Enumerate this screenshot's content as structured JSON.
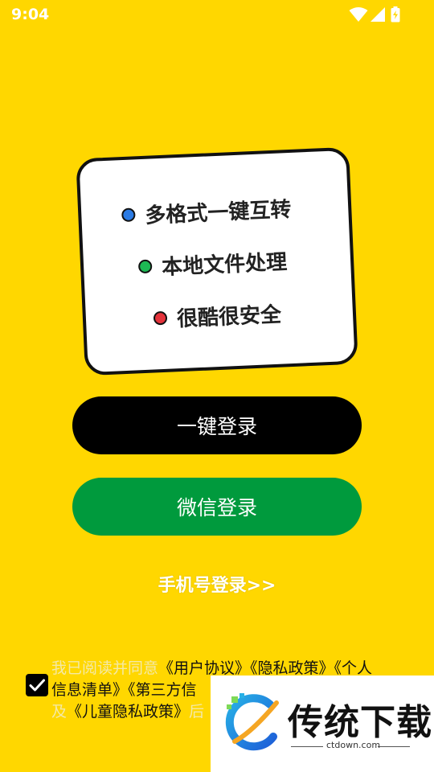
{
  "status_bar": {
    "time": "9:04",
    "icons": [
      "wifi-icon",
      "signal-icon",
      "battery-charging-icon"
    ]
  },
  "features": [
    {
      "text": "多格式一键互转",
      "dot_color": "#2B7BE4"
    },
    {
      "text": "本地文件处理",
      "dot_color": "#1DB954"
    },
    {
      "text": "很酷很安全",
      "dot_color": "#E4333B"
    }
  ],
  "buttons": {
    "onekey_login": "一键登录",
    "wechat_login": "微信登录",
    "phone_login": "手机号登录>>"
  },
  "agreement": {
    "checked": true,
    "line1_plain": "我已阅读并同意",
    "link_user": "《用户协议》",
    "link_privacy": "《隐私政策》",
    "link_personal_1": "《个人",
    "link_personal_2": "信息清单》",
    "link_thirdparty_partial": "《第三方信",
    "line3_plain_start": "及",
    "link_child": "《儿童隐私政策》",
    "line3_partial": "后"
  },
  "watermark": {
    "title": "传统下载",
    "domain": "ctdown.com"
  },
  "colors": {
    "background": "#FFD700",
    "onekey_button": "#000000",
    "wechat_button": "#009A3D"
  }
}
